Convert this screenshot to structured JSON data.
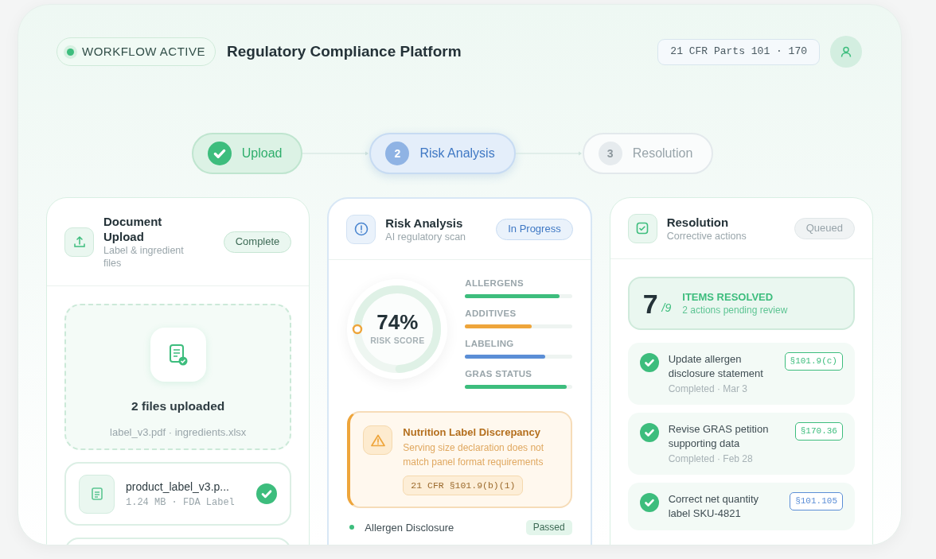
{
  "header": {
    "status": {
      "label": "WORKFLOW ACTIVE",
      "active": true
    },
    "title": "Regulatory Compliance Platform",
    "regulation": "21 CFR Parts 101 · 170"
  },
  "steps": [
    {
      "label": "Upload",
      "completed": true,
      "selected": false
    },
    {
      "number": "2",
      "label": "Risk Analysis",
      "completed": false,
      "selected": true
    },
    {
      "number": "3",
      "label": "Resolution",
      "completed": false,
      "selected": false
    }
  ],
  "upload": {
    "title": "Document Upload",
    "subtitle": "Label & ingredient files",
    "badge": "Complete",
    "summary": "2 files uploaded",
    "file_list": "label_v3.pdf · ingredients.xlsx",
    "files": [
      {
        "name": "product_label_v3.p...",
        "meta": "1.24 MB · FDA Label",
        "verified": true
      }
    ]
  },
  "analysis": {
    "title": "Risk Analysis",
    "subtitle": "AI regulatory scan",
    "badge": "In Progress",
    "score": "74%",
    "score_label": "RISK SCORE",
    "metrics": [
      {
        "label": "ALLERGENS",
        "level": 0.88,
        "color": "#3dbd7d"
      },
      {
        "label": "ADDITIVES",
        "level": 0.62,
        "color": "#eea53b"
      },
      {
        "label": "LABELING",
        "level": 0.75,
        "color": "#5b8ed6"
      },
      {
        "label": "GRAS STATUS",
        "level": 0.95,
        "color": "#3dbd7d"
      }
    ],
    "alert": {
      "title": "Nutrition Label Discrepancy",
      "message": "Serving size declaration does not match panel format requirements",
      "citation": "21 CFR §101.9(b)(1)"
    },
    "checks": [
      {
        "label": "Allergen Disclosure",
        "status": "Passed",
        "kind": "passed"
      }
    ]
  },
  "resolution": {
    "title": "Resolution",
    "subtitle": "Corrective actions",
    "badge": "Queued",
    "resolved": "7",
    "total": "/9",
    "summary_title": "ITEMS RESOLVED",
    "summary_note": "2 actions pending review",
    "actions": [
      {
        "title": "Update allergen disclosure statement",
        "meta": "Completed · Mar 3",
        "citation": "§101.9(c)",
        "color": "#3dbd7d",
        "done": true
      },
      {
        "title": "Revise GRAS petition supporting data",
        "meta": "Completed · Feb 28",
        "citation": "§170.36",
        "color": "#3dbd7d",
        "done": true
      },
      {
        "title": "Correct net quantity label SKU-4821",
        "citation": "§101.105",
        "color": "#5b8ed6",
        "done": true
      }
    ]
  }
}
